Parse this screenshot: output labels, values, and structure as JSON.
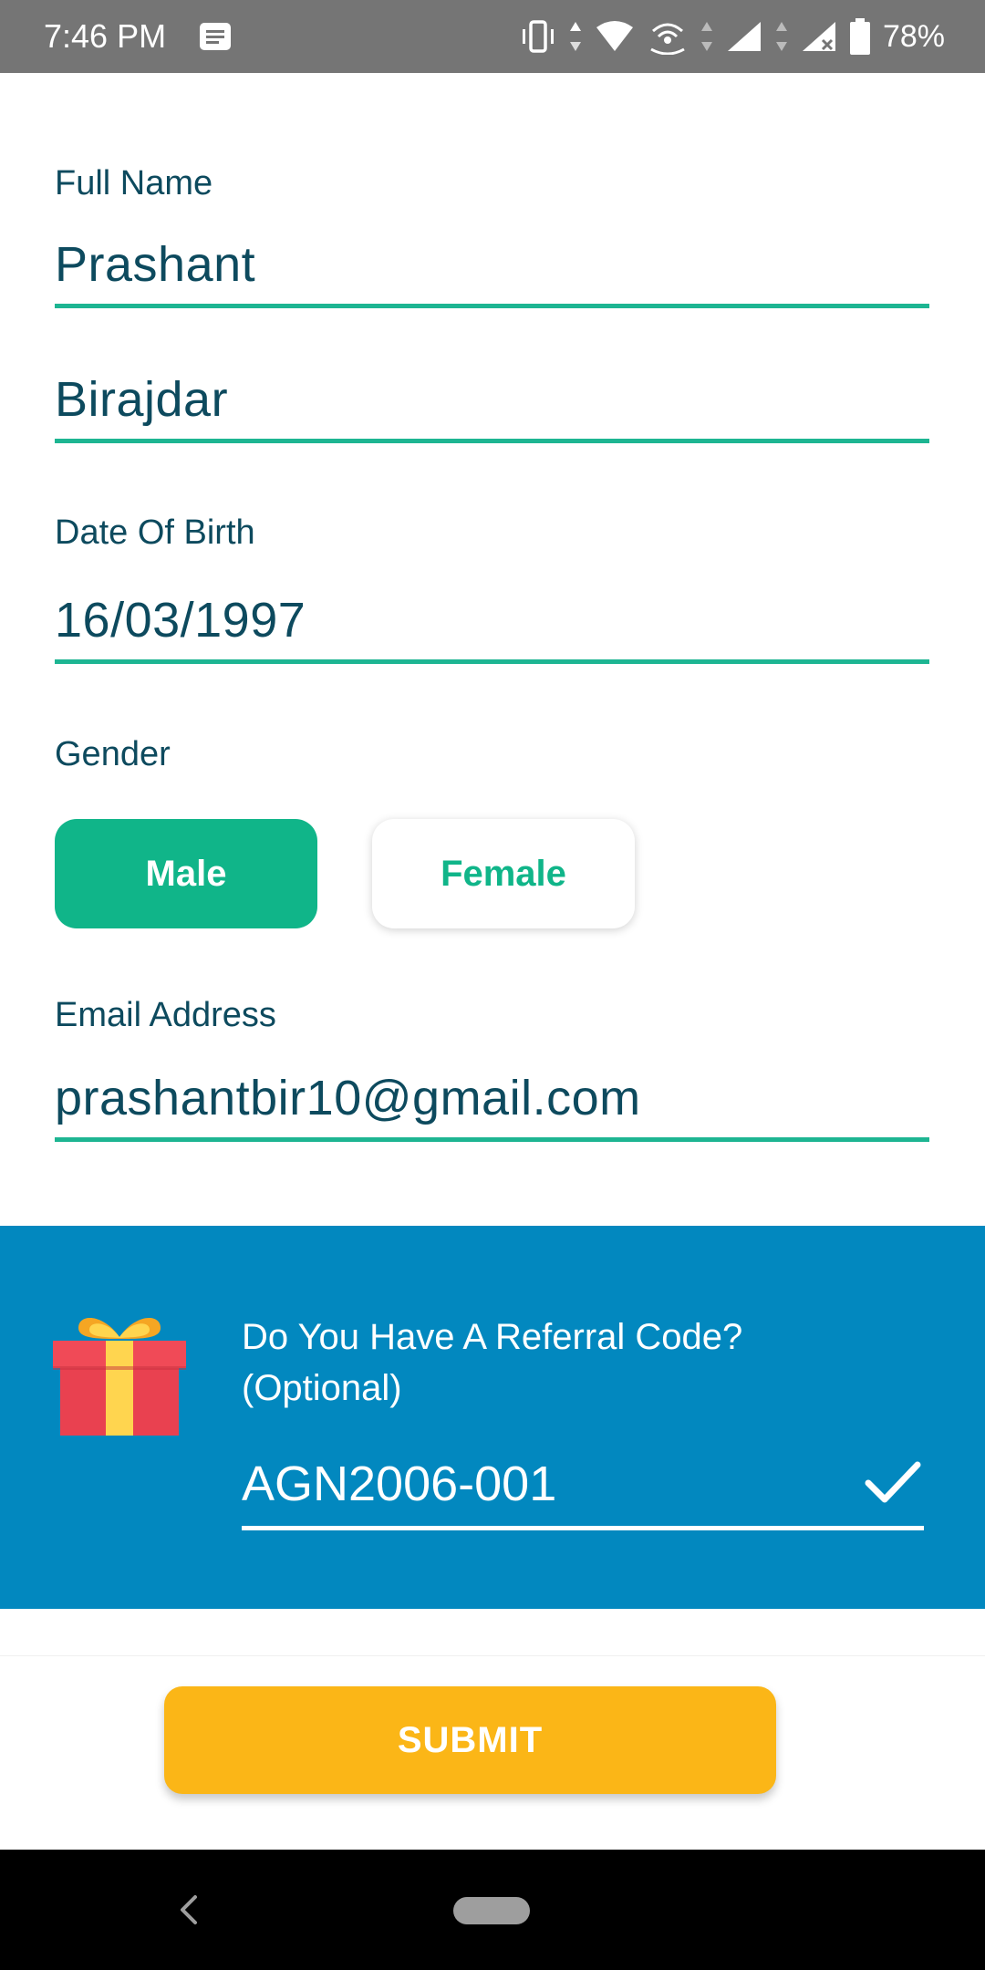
{
  "status_bar": {
    "time": "7:46 PM",
    "battery": "78%"
  },
  "form": {
    "full_name_label": "Full Name",
    "first_name": "Prashant",
    "last_name": "Birajdar",
    "dob_label": "Date Of Birth",
    "dob": "16/03/1997",
    "gender_label": "Gender",
    "gender_options": [
      "Male",
      "Female"
    ],
    "gender_selected": "Male",
    "email_label": "Email Address",
    "email": "prashantbir10@gmail.com"
  },
  "referral": {
    "question_line1": "Do You Have A Referral Code?",
    "question_line2": "(Optional)",
    "code": "AGN2006-001"
  },
  "submit_label": "SUBMIT",
  "colors": {
    "accent_green": "#10b589",
    "label_text": "#0d4a5e",
    "referral_bg": "#0288bf",
    "submit_bg": "#fbb617",
    "status_bar_bg": "#757575"
  },
  "icons": {
    "notification": "message-icon",
    "gift": "gift-icon",
    "check": "check-icon",
    "back": "back-icon"
  }
}
